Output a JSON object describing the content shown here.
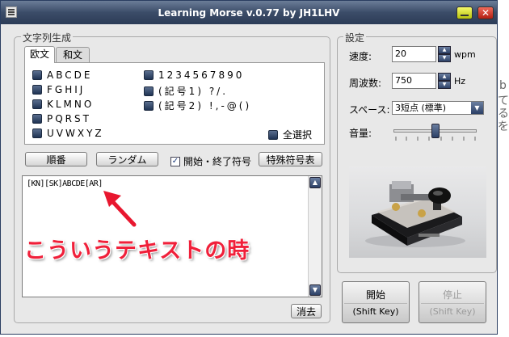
{
  "background": {
    "glyphs": [
      "|",
      "b",
      "て",
      "る",
      "を"
    ]
  },
  "window": {
    "title": "Learning Morse v.0.77 by JH1LHV",
    "minimize_icon": "minimize-icon",
    "close_label": "✕"
  },
  "left_group": {
    "label": "文字列生成",
    "tabs": [
      {
        "label": "欧文",
        "active": true
      },
      {
        "label": "和文",
        "active": false
      }
    ],
    "checkboxes": {
      "col1": [
        "ABCDE",
        "FGHIJ",
        "KLMNO",
        "PQRST",
        "UVWXYZ"
      ],
      "col2": [
        "1234567890",
        "(記号1) ?/.",
        "(記号2) !,-@()"
      ],
      "select_all": "全選択"
    },
    "buttons": {
      "order": "順番",
      "random": "ランダム",
      "special": "特殊符号表"
    },
    "start_end_check": {
      "label": "開始・終了符号",
      "checked": true
    },
    "text_area": {
      "value": "[KN][SK]ABCDE[AR]"
    },
    "clear_button": "消去"
  },
  "annotation": {
    "text": "こういうテキストの時",
    "arrow_color": "#e8172f"
  },
  "settings": {
    "label": "設定",
    "speed": {
      "label": "速度:",
      "value": "20",
      "unit": "wpm"
    },
    "frequency": {
      "label": "周波数:",
      "value": "750",
      "unit": "Hz"
    },
    "space": {
      "label": "スペース:",
      "value": "3短点 (標準)"
    },
    "volume": {
      "label": "音量:",
      "level": 0.5
    }
  },
  "controls": {
    "start": {
      "label": "開始",
      "shortcut": "(Shift Key)"
    },
    "stop": {
      "label": "停止",
      "shortcut": "(Shift Key)",
      "disabled": true
    }
  },
  "colors": {
    "titlebar": "#3b4c68",
    "checkbox_fill": "#2c4066",
    "annotation": "#f0203a"
  }
}
